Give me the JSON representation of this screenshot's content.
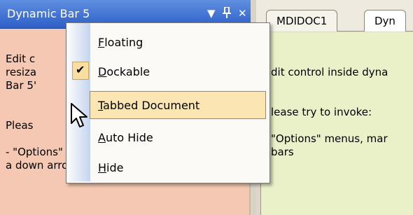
{
  "dock_pane": {
    "title": "Dynamic Bar 5",
    "caption_buttons": {
      "menu": "▼",
      "pin": "📌",
      "close": "✕"
    },
    "body_text": "Edit c\nresiza\nBar 5'\n\n\nPleas\n\n- \"Options\" menus, marked with\na down arrow in captions of"
  },
  "mdi": {
    "tabs": [
      {
        "label": "MDIDOC1"
      },
      {
        "label": "Dyn"
      }
    ],
    "doc_text": "dit control inside dyna\n\n\nlease try to invoke:\n\n\"Options\" menus, mar\nbars"
  },
  "menu": {
    "items": [
      {
        "pre": "",
        "ul": "F",
        "post": "loating",
        "checked": false
      },
      {
        "pre": "",
        "ul": "D",
        "post": "ockable",
        "checked": true
      },
      {
        "pre": "",
        "ul": "T",
        "post": "abbed Document",
        "checked": false
      },
      {
        "pre": "",
        "ul": "A",
        "post": "uto Hide",
        "checked": false
      },
      {
        "pre": "",
        "ul": "H",
        "post": "ide",
        "checked": false
      }
    ],
    "highlighted_index": 2
  },
  "colors": {
    "caption": "#2d5fc8",
    "dock_body": "#f4c8b2",
    "doc_body": "#eaf1c8",
    "menu_highlight": "#fbe6b3"
  }
}
